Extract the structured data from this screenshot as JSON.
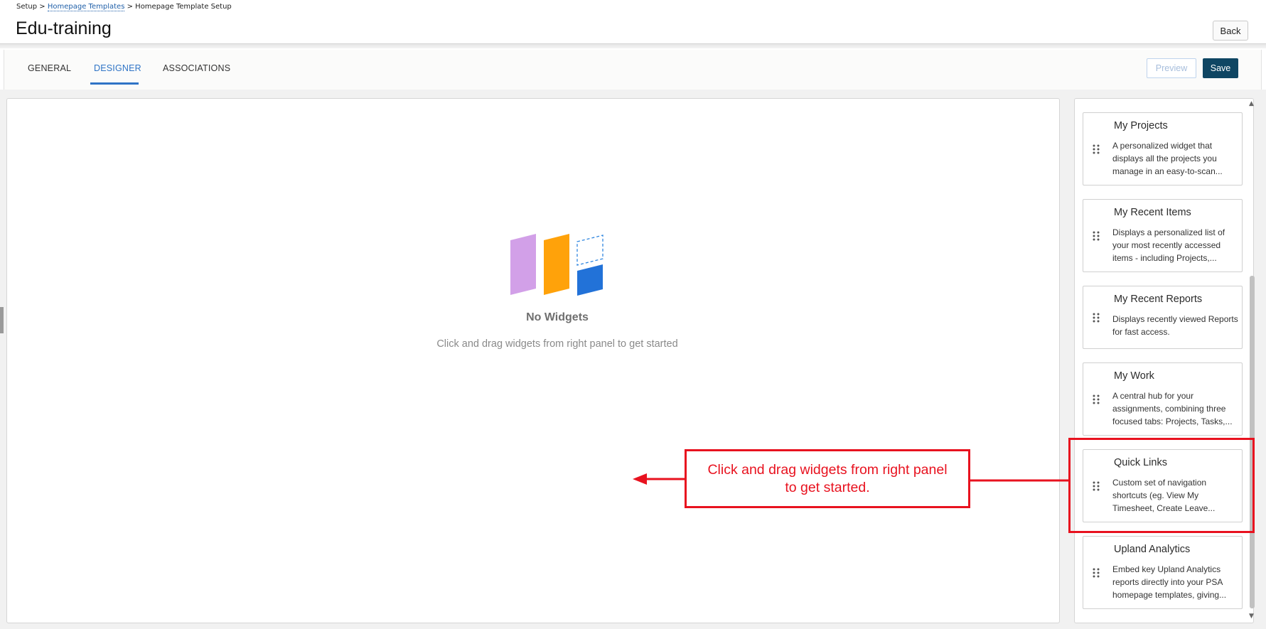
{
  "breadcrumb": {
    "root": "Setup",
    "sep1": ">",
    "link": "Homepage Templates",
    "sep2": ">",
    "current": "Homepage Template Setup"
  },
  "page": {
    "title": "Edu-training"
  },
  "header": {
    "back_label": "Back"
  },
  "tabs": [
    {
      "label": "GENERAL",
      "active": false
    },
    {
      "label": "DESIGNER",
      "active": true
    },
    {
      "label": "ASSOCIATIONS",
      "active": false
    }
  ],
  "toolbar": {
    "preview_label": "Preview",
    "save_label": "Save"
  },
  "canvas": {
    "empty_title": "No Widgets",
    "empty_subtitle": "Click and drag widgets from right panel to get started"
  },
  "widgets": [
    {
      "title": "My Projects",
      "description": "A personalized widget that displays all the projects you manage in an easy-to-scan..."
    },
    {
      "title": "My Recent Items",
      "description": "Displays a personalized list of your most recently accessed items - including Projects,..."
    },
    {
      "title": "My Recent Reports",
      "description": "Displays recently viewed Reports for fast access."
    },
    {
      "title": "My Work",
      "description": "A central hub for your assignments, combining three focused tabs: Projects, Tasks,..."
    },
    {
      "title": "Quick Links",
      "description": "Custom set of navigation shortcuts (eg. View My Timesheet, Create Leave..."
    },
    {
      "title": "Upland Analytics",
      "description": "Embed key Upland Analytics reports directly into your PSA homepage templates, giving..."
    }
  ],
  "annotation": {
    "callout_line1": "Click and drag widgets from right panel",
    "callout_line2": "to get started."
  },
  "colors": {
    "accent_blue": "#2f74c6",
    "save_button": "#0f4663",
    "annotation_red": "#e8121f",
    "illustration_purple": "#d2a0e8",
    "illustration_orange": "#ffa20a",
    "illustration_blue": "#2272d8"
  }
}
